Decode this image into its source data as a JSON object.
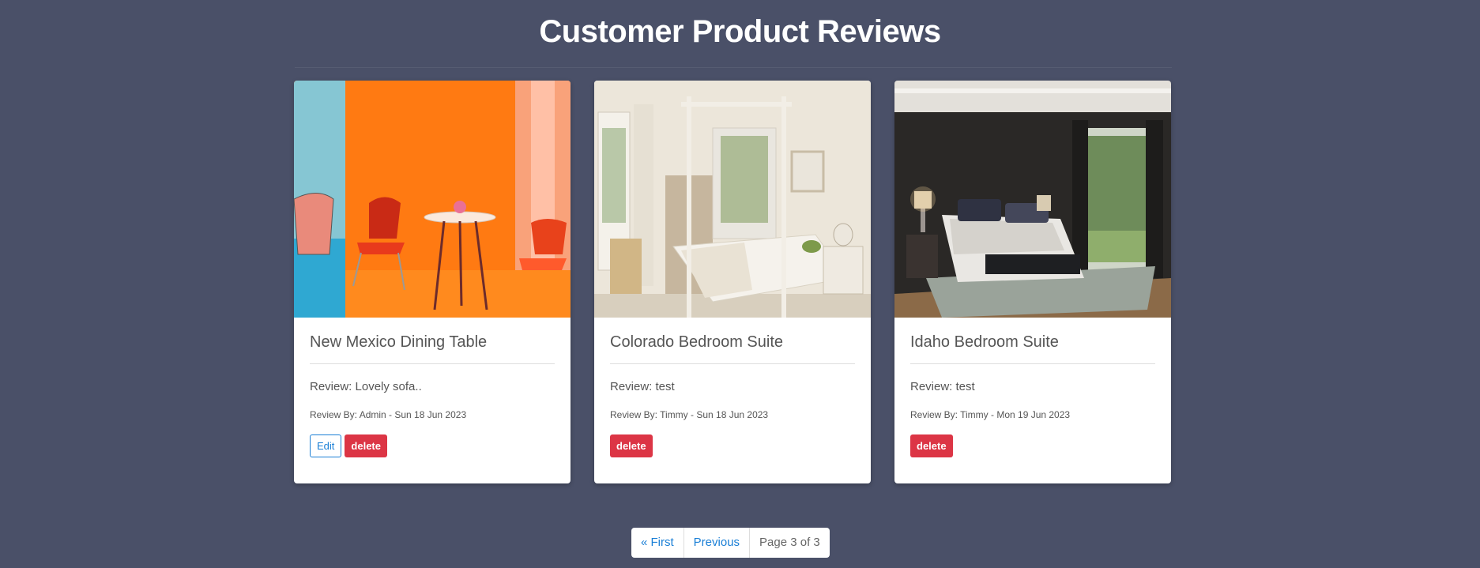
{
  "page": {
    "title": "Customer Product Reviews"
  },
  "reviews": [
    {
      "product": "New Mexico Dining Table",
      "review": "Review: Lovely sofa..",
      "meta": "Review By: Admin - Sun 18 Jun 2023",
      "edit_label": "Edit",
      "delete_label": "delete"
    },
    {
      "product": "Colorado Bedroom Suite",
      "review": "Review: test",
      "meta": "Review By: Timmy - Sun 18 Jun 2023",
      "delete_label": "delete"
    },
    {
      "product": "Idaho Bedroom Suite",
      "review": "Review: test",
      "meta": "Review By: Timmy - Mon 19 Jun 2023",
      "delete_label": "delete"
    }
  ],
  "pagination": {
    "first": "« First",
    "previous": "Previous",
    "current": "Page 3 of 3"
  },
  "colors": {
    "background": "#4a5068",
    "link": "#1a7fd6",
    "danger": "#dc3545"
  }
}
